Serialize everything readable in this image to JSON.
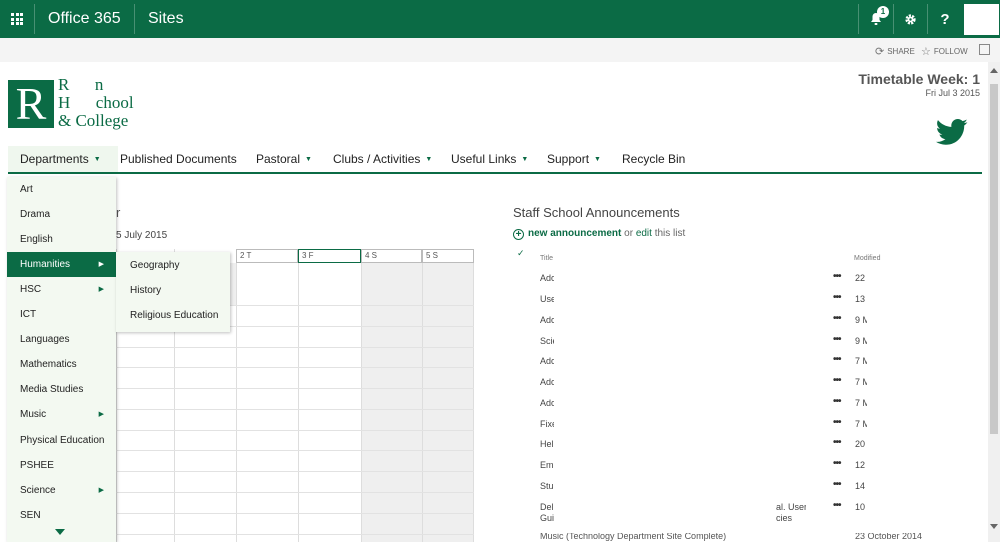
{
  "topbar": {
    "brand": "Office 365",
    "sites": "Sites",
    "notification_count": "1",
    "settings_icon": "gear-icon",
    "help_label": "?"
  },
  "subbar": {
    "share_label": "SHARE",
    "follow_label": "FOLLOW"
  },
  "logo": {
    "mark": "R",
    "line1": "R      n",
    "line2": "H      chool",
    "line3": "& College"
  },
  "timetable": {
    "week": "Timetable Week: 1",
    "date": "Fri Jul 3 2015"
  },
  "nav": {
    "items": [
      {
        "label": "Departments",
        "dropdown": true
      },
      {
        "label": "Published Documents",
        "dropdown": false
      },
      {
        "label": "Pastoral",
        "dropdown": true
      },
      {
        "label": "Clubs / Activities",
        "dropdown": true
      },
      {
        "label": "Useful Links",
        "dropdown": true
      },
      {
        "label": "Support",
        "dropdown": true
      },
      {
        "label": "Recycle Bin",
        "dropdown": false
      }
    ]
  },
  "departments": {
    "items": [
      {
        "label": "Art",
        "sub": ""
      },
      {
        "label": "Drama",
        "sub": ""
      },
      {
        "label": "English",
        "sub": ""
      },
      {
        "label": "Humanities",
        "sub": "▶"
      },
      {
        "label": "HSC",
        "sub": "▶"
      },
      {
        "label": "ICT",
        "sub": ""
      },
      {
        "label": "Languages",
        "sub": ""
      },
      {
        "label": "Mathematics",
        "sub": ""
      },
      {
        "label": "Media Studies",
        "sub": ""
      },
      {
        "label": "Music",
        "sub": "▶"
      },
      {
        "label": "Physical Education",
        "sub": ""
      },
      {
        "label": "PSHEE",
        "sub": ""
      },
      {
        "label": "Science",
        "sub": "▶"
      },
      {
        "label": "SEN",
        "sub": ""
      }
    ],
    "humanities": [
      "Geography",
      "History",
      "Religious Education"
    ]
  },
  "calendar": {
    "title_fragment": "r",
    "date_fragment": "5 July 2015",
    "headers": [
      "2 T",
      "3 F",
      "4 S",
      "5 S"
    ]
  },
  "announcements": {
    "title": "Staff School Announcements",
    "new_link": "new announcement",
    "or_text": " or ",
    "edit_link": "edit",
    "list_text": " this list",
    "col_title": "Title",
    "col_modified": "Modified",
    "rows": [
      {
        "title": "Adc",
        "title2": "",
        "extra": "",
        "extra2": "",
        "modified": "22"
      },
      {
        "title": "Use",
        "title2": "",
        "extra": "",
        "extra2": "",
        "modified": "13"
      },
      {
        "title": "Adc",
        "title2": "",
        "extra": "",
        "extra2": "",
        "modified": "9 M"
      },
      {
        "title": "Scie",
        "title2": "",
        "extra": "",
        "extra2": "",
        "modified": "9 M"
      },
      {
        "title": "Adc",
        "title2": "",
        "extra": "",
        "extra2": "",
        "modified": "7 M"
      },
      {
        "title": "Adc",
        "title2": "",
        "extra": "",
        "extra2": "",
        "modified": "7 M"
      },
      {
        "title": "Adc",
        "title2": "",
        "extra": "",
        "extra2": "",
        "modified": "7 M"
      },
      {
        "title": "Fixe",
        "title2": "",
        "extra": "",
        "extra2": "",
        "modified": "7 M"
      },
      {
        "title": "Hel",
        "title2": "",
        "extra": "",
        "extra2": "",
        "modified": "20"
      },
      {
        "title": "Em",
        "title2": "",
        "extra": "",
        "extra2": "",
        "modified": "12"
      },
      {
        "title": "Stu",
        "title2": "",
        "extra": "",
        "extra2": "",
        "modified": "14"
      },
      {
        "title": "Del",
        "title2": "Gui",
        "extra": "al. User",
        "extra2": "cies",
        "modified": "10"
      }
    ],
    "last_row_title": "Music  (Technology Department Site Complete)",
    "last_row_modified": "23 October 2014"
  },
  "colors": {
    "brand_green": "#0b6b45"
  }
}
